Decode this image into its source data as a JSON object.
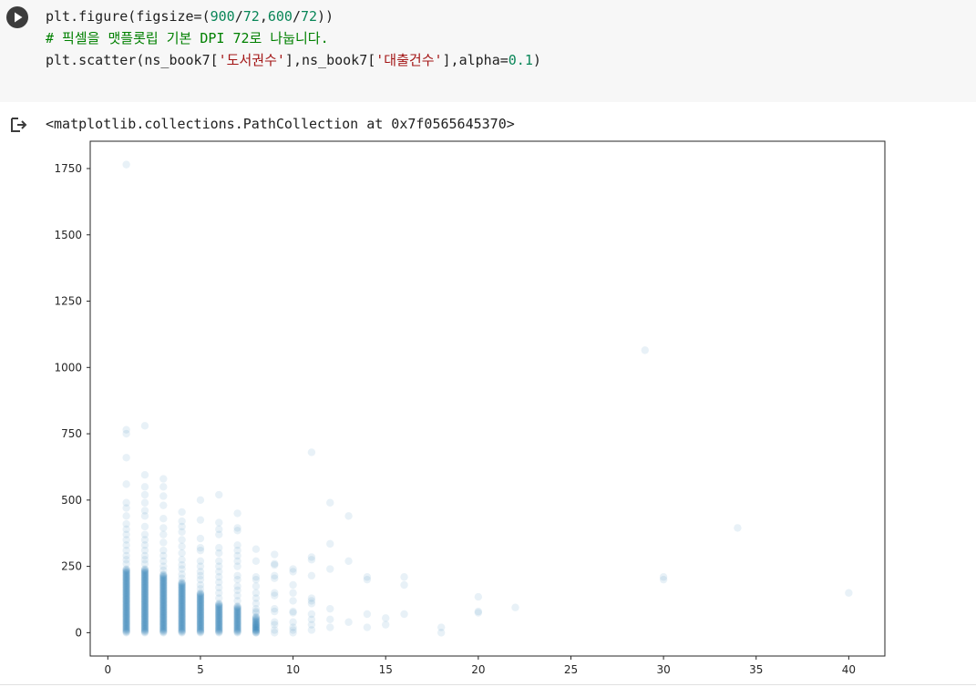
{
  "cell": {
    "code_lines": [
      [
        {
          "t": "plt.figure(figsize=(",
          "c": ""
        },
        {
          "t": "900",
          "c": "num"
        },
        {
          "t": "/",
          "c": ""
        },
        {
          "t": "72",
          "c": "num"
        },
        {
          "t": ",",
          "c": ""
        },
        {
          "t": "600",
          "c": "num"
        },
        {
          "t": "/",
          "c": ""
        },
        {
          "t": "72",
          "c": "num"
        },
        {
          "t": "))",
          "c": ""
        }
      ],
      [
        {
          "t": "# 픽셀을 맷플롯립 기본 DPI 72로 나눕니다.",
          "c": "cmt"
        }
      ],
      [
        {
          "t": "plt.scatter(ns_book7[",
          "c": ""
        },
        {
          "t": "'도서권수'",
          "c": "str"
        },
        {
          "t": "],ns_book7[",
          "c": ""
        },
        {
          "t": "'대출건수'",
          "c": "str"
        },
        {
          "t": "],alpha=",
          "c": ""
        },
        {
          "t": "0.1",
          "c": "num"
        },
        {
          "t": ")",
          "c": ""
        }
      ]
    ]
  },
  "output": {
    "text": "<matplotlib.collections.PathCollection at 0x7f0565645370>"
  },
  "colors": {
    "marker": "#1f77b4",
    "cell_bg": "#f7f7f7",
    "axis": "#262626"
  },
  "chart_data": {
    "type": "scatter",
    "alpha": 0.1,
    "xlim": [
      -0.95,
      41.95
    ],
    "ylim": [
      -88,
      1853
    ],
    "xticks": [
      0,
      5,
      10,
      15,
      20,
      25,
      30,
      35,
      40
    ],
    "yticks": [
      0,
      250,
      500,
      750,
      1000,
      1250,
      1500,
      1750
    ],
    "dense_columns": [
      {
        "x": 1,
        "y_max": 240
      },
      {
        "x": 2,
        "y_max": 240
      },
      {
        "x": 3,
        "y_max": 220
      },
      {
        "x": 4,
        "y_max": 190
      },
      {
        "x": 5,
        "y_max": 150
      },
      {
        "x": 6,
        "y_max": 110
      },
      {
        "x": 7,
        "y_max": 100
      },
      {
        "x": 8,
        "y_max": 60
      }
    ],
    "points": [
      [
        1,
        1765
      ],
      [
        1,
        765
      ],
      [
        1,
        750
      ],
      [
        1,
        660
      ],
      [
        1,
        560
      ],
      [
        1,
        490
      ],
      [
        1,
        470
      ],
      [
        1,
        440
      ],
      [
        1,
        410
      ],
      [
        1,
        390
      ],
      [
        1,
        370
      ],
      [
        1,
        350
      ],
      [
        1,
        330
      ],
      [
        1,
        310
      ],
      [
        1,
        290
      ],
      [
        1,
        275
      ],
      [
        1,
        260
      ],
      [
        2,
        780
      ],
      [
        2,
        595
      ],
      [
        2,
        550
      ],
      [
        2,
        520
      ],
      [
        2,
        490
      ],
      [
        2,
        460
      ],
      [
        2,
        440
      ],
      [
        2,
        400
      ],
      [
        2,
        370
      ],
      [
        2,
        350
      ],
      [
        2,
        330
      ],
      [
        2,
        310
      ],
      [
        2,
        290
      ],
      [
        2,
        275
      ],
      [
        2,
        260
      ],
      [
        3,
        580
      ],
      [
        3,
        550
      ],
      [
        3,
        515
      ],
      [
        3,
        480
      ],
      [
        3,
        430
      ],
      [
        3,
        395
      ],
      [
        3,
        370
      ],
      [
        3,
        340
      ],
      [
        3,
        310
      ],
      [
        3,
        290
      ],
      [
        3,
        270
      ],
      [
        3,
        250
      ],
      [
        3,
        235
      ],
      [
        4,
        455
      ],
      [
        4,
        420
      ],
      [
        4,
        400
      ],
      [
        4,
        380
      ],
      [
        4,
        350
      ],
      [
        4,
        325
      ],
      [
        4,
        300
      ],
      [
        4,
        275
      ],
      [
        4,
        255
      ],
      [
        4,
        240
      ],
      [
        4,
        220
      ],
      [
        4,
        205
      ],
      [
        5,
        500
      ],
      [
        5,
        425
      ],
      [
        5,
        355
      ],
      [
        5,
        320
      ],
      [
        5,
        310
      ],
      [
        5,
        270
      ],
      [
        5,
        250
      ],
      [
        5,
        230
      ],
      [
        5,
        215
      ],
      [
        5,
        200
      ],
      [
        5,
        180
      ],
      [
        5,
        165
      ],
      [
        6,
        520
      ],
      [
        6,
        415
      ],
      [
        6,
        390
      ],
      [
        6,
        370
      ],
      [
        6,
        320
      ],
      [
        6,
        300
      ],
      [
        6,
        270
      ],
      [
        6,
        250
      ],
      [
        6,
        230
      ],
      [
        6,
        210
      ],
      [
        6,
        190
      ],
      [
        6,
        170
      ],
      [
        6,
        150
      ],
      [
        6,
        130
      ],
      [
        7,
        450
      ],
      [
        7,
        395
      ],
      [
        7,
        385
      ],
      [
        7,
        330
      ],
      [
        7,
        310
      ],
      [
        7,
        290
      ],
      [
        7,
        270
      ],
      [
        7,
        250
      ],
      [
        7,
        215
      ],
      [
        7,
        200
      ],
      [
        7,
        175
      ],
      [
        7,
        160
      ],
      [
        7,
        140
      ],
      [
        7,
        120
      ],
      [
        8,
        315
      ],
      [
        8,
        270
      ],
      [
        8,
        210
      ],
      [
        8,
        200
      ],
      [
        8,
        175
      ],
      [
        8,
        150
      ],
      [
        8,
        130
      ],
      [
        8,
        110
      ],
      [
        8,
        90
      ],
      [
        8,
        80
      ],
      [
        8,
        75
      ],
      [
        8,
        30
      ],
      [
        8,
        20
      ],
      [
        8,
        10
      ],
      [
        8,
        0
      ],
      [
        9,
        295
      ],
      [
        9,
        260
      ],
      [
        9,
        255
      ],
      [
        9,
        215
      ],
      [
        9,
        205
      ],
      [
        9,
        150
      ],
      [
        9,
        140
      ],
      [
        9,
        90
      ],
      [
        9,
        80
      ],
      [
        9,
        40
      ],
      [
        9,
        30
      ],
      [
        9,
        10
      ],
      [
        9,
        0
      ],
      [
        10,
        240
      ],
      [
        10,
        230
      ],
      [
        10,
        180
      ],
      [
        10,
        150
      ],
      [
        10,
        120
      ],
      [
        10,
        80
      ],
      [
        10,
        75
      ],
      [
        10,
        40
      ],
      [
        10,
        20
      ],
      [
        10,
        10
      ],
      [
        10,
        0
      ],
      [
        11,
        680
      ],
      [
        11,
        285
      ],
      [
        11,
        275
      ],
      [
        11,
        215
      ],
      [
        11,
        130
      ],
      [
        11,
        120
      ],
      [
        11,
        110
      ],
      [
        11,
        70
      ],
      [
        11,
        50
      ],
      [
        11,
        30
      ],
      [
        11,
        10
      ],
      [
        12,
        490
      ],
      [
        12,
        335
      ],
      [
        12,
        240
      ],
      [
        12,
        90
      ],
      [
        12,
        50
      ],
      [
        12,
        20
      ],
      [
        13,
        440
      ],
      [
        13,
        270
      ],
      [
        13,
        40
      ],
      [
        14,
        210
      ],
      [
        14,
        200
      ],
      [
        14,
        70
      ],
      [
        14,
        20
      ],
      [
        15,
        55
      ],
      [
        15,
        30
      ],
      [
        16,
        210
      ],
      [
        16,
        180
      ],
      [
        16,
        70
      ],
      [
        18,
        20
      ],
      [
        18,
        0
      ],
      [
        20,
        135
      ],
      [
        20,
        80
      ],
      [
        20,
        75
      ],
      [
        22,
        95
      ],
      [
        29,
        1065
      ],
      [
        30,
        210
      ],
      [
        30,
        200
      ],
      [
        34,
        395
      ],
      [
        40,
        150
      ]
    ]
  }
}
